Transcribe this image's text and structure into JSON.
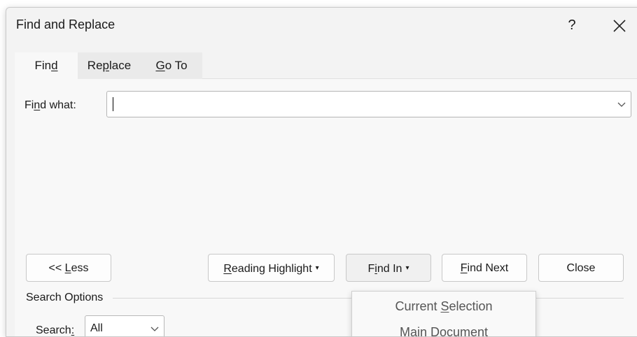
{
  "dialog": {
    "title": "Find and Replace",
    "help_label": "?"
  },
  "tabs": [
    {
      "pre": "Fin",
      "ul": "d",
      "post": ""
    },
    {
      "pre": "Re",
      "ul": "p",
      "post": "lace"
    },
    {
      "pre": "",
      "ul": "G",
      "post": "o To"
    }
  ],
  "find": {
    "label_pre": "Fi",
    "label_ul": "n",
    "label_post": "d what:",
    "value": ""
  },
  "buttons": {
    "less": {
      "pre": "<< ",
      "ul": "L",
      "post": "ess"
    },
    "reading_highlight": {
      "pre": "",
      "ul": "R",
      "post": "eading Highlight"
    },
    "find_in": {
      "pre": "F",
      "ul": "i",
      "post": "nd In"
    },
    "find_next": {
      "pre": "",
      "ul": "F",
      "post": "ind Next"
    },
    "close": "Close"
  },
  "search_options": {
    "heading": "Search Options",
    "search_label_pre": "Search",
    "search_label_ul": ":",
    "search_value": "All"
  },
  "find_in_menu": [
    {
      "pre": "Current ",
      "ul": "S",
      "post": "election"
    },
    {
      "pre": "",
      "ul": "M",
      "post": "ain Document"
    }
  ],
  "icons": {
    "close": "close-icon",
    "chevron": "chevron-down-icon",
    "dropdown_arrow": "dropdown-arrow-icon"
  }
}
